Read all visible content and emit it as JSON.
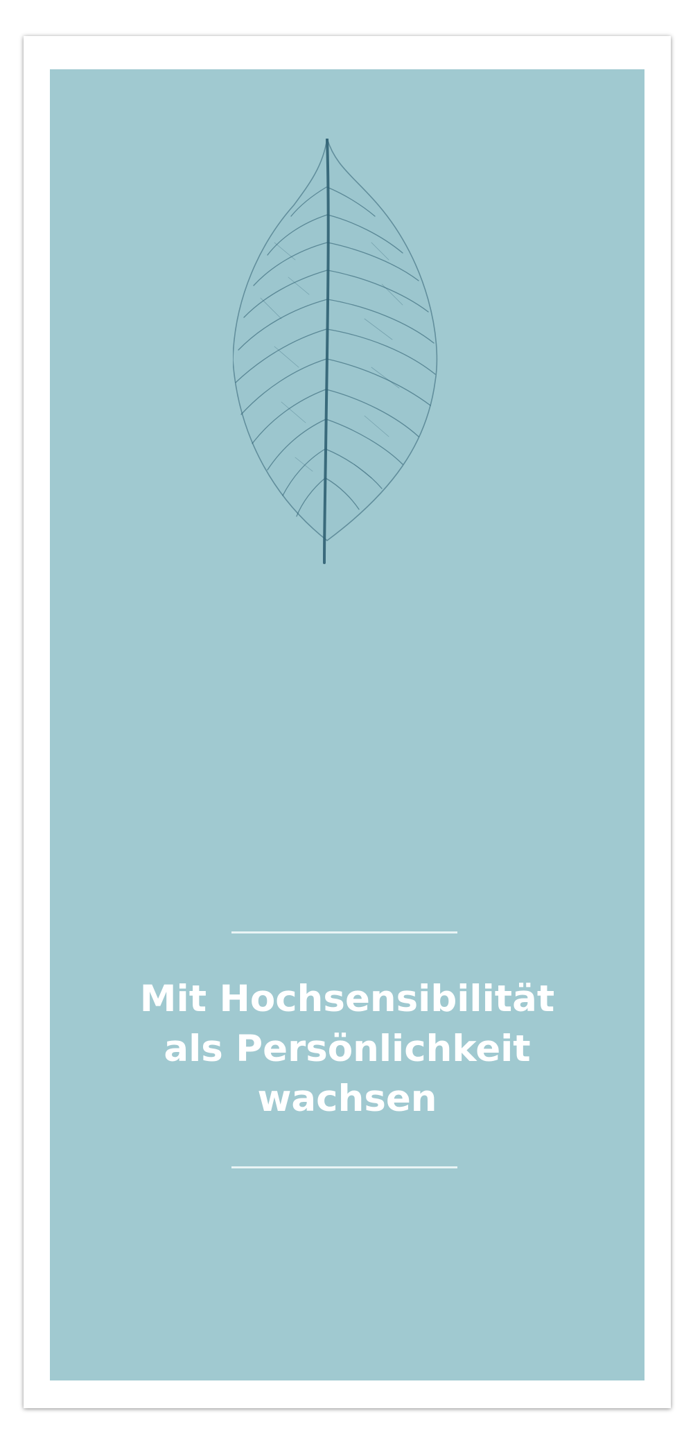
{
  "title": {
    "lines": [
      "Mit Hochsensibilität",
      "als Persönlichkeit",
      "wachsen"
    ]
  },
  "colors": {
    "panel": "#a0c9d0",
    "title_text": "#ffffff",
    "leaf_veins": "#2f5f72"
  },
  "icons": {
    "leaf": "skeleton-leaf-icon"
  }
}
